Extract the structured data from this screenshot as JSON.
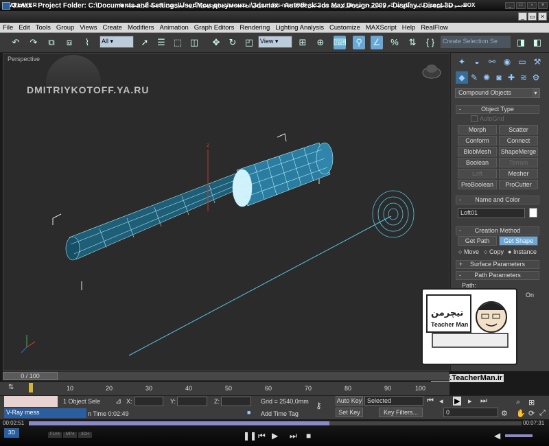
{
  "kmplayer": {
    "logo": "KMPLAYER",
    "title": "مجموعه آموزشی جامع ، گام به گام و کاربردی نرم افزار تری دی مکس 3ds max 2016 | مدرس : سعید فدایی (تیچرمن) گروه آموزشی پادشاه گرافیست ها",
    "box_label": "BOX",
    "time_elapsed": "00:02:51",
    "time_total": "00:07:31",
    "progress_fraction": 0.61,
    "mode_labels": [
      "FLV4",
      "MP4",
      "3CH"
    ]
  },
  "max": {
    "title": "3.max   - Project Folder: C:\\Documents and Settings\\User\\Мои документы\\3dsmax   - Autodesk 3ds Max Design 2009   - Display : Direct 3D",
    "menu": [
      "File",
      "Edit",
      "Tools",
      "Group",
      "Views",
      "Create",
      "Modifiers",
      "Animation",
      "Graph Editors",
      "Rendering",
      "Lighting Analysis",
      "Customize",
      "MAXScript",
      "Help",
      "RealFlow"
    ],
    "toolbar": {
      "filter_value": "All",
      "refcoord_value": "View",
      "selection_set_placeholder": "Create Selection Se"
    },
    "viewport": {
      "label": "Perspective",
      "watermark": "DMITRIYKOTOFF.YA.RU"
    },
    "command_panel": {
      "category": "Compound Objects",
      "object_type": {
        "header": "Object Type",
        "autogrid": "AutoGrid",
        "buttons": [
          "Morph",
          "Scatter",
          "Conform",
          "Connect",
          "BlobMesh",
          "ShapeMerge",
          "Boolean",
          "Terrain",
          "Loft",
          "Mesher",
          "ProBoolean",
          "ProCutter"
        ]
      },
      "name_color": {
        "header": "Name and Color",
        "name_value": "Loft01",
        "color": "#ffffff"
      },
      "creation_method": {
        "header": "Creation Method",
        "get_path": "Get Path",
        "get_shape": "Get Shape",
        "move": "Move",
        "copy": "Copy",
        "instance": "Instance"
      },
      "surface_params": "Surface Parameters",
      "path_params": "Path Parameters",
      "path_label": "Path:",
      "on_label": "On"
    },
    "timeline": {
      "frame_display": "0 / 100",
      "ticks": [
        "10",
        "20",
        "30",
        "40",
        "50",
        "60",
        "70",
        "80",
        "90",
        "100"
      ]
    },
    "status": {
      "vray_label": "V-Ray mess",
      "objects_selected": "1 Object Sele",
      "x_label": "X:",
      "y_label": "Y:",
      "z_label": "Z:",
      "grid": "Grid = 2540,0mm",
      "auto_key": "Auto Key",
      "selected": "Selected",
      "set_key": "Set Key",
      "key_filters": "Key Filters...",
      "render_time": "n Time  0:02:49",
      "add_time_tag": "Add Time Tag",
      "frame_field": "0"
    }
  },
  "overlay": {
    "brand_fa": "تیچرمن",
    "brand_en": "Teacher Man",
    "url": "www.TeacherMan.ir"
  },
  "colors": {
    "accent": "#6aa6d6",
    "wire": "#55c8e8",
    "viewport_bg": "#2b2b2b"
  }
}
